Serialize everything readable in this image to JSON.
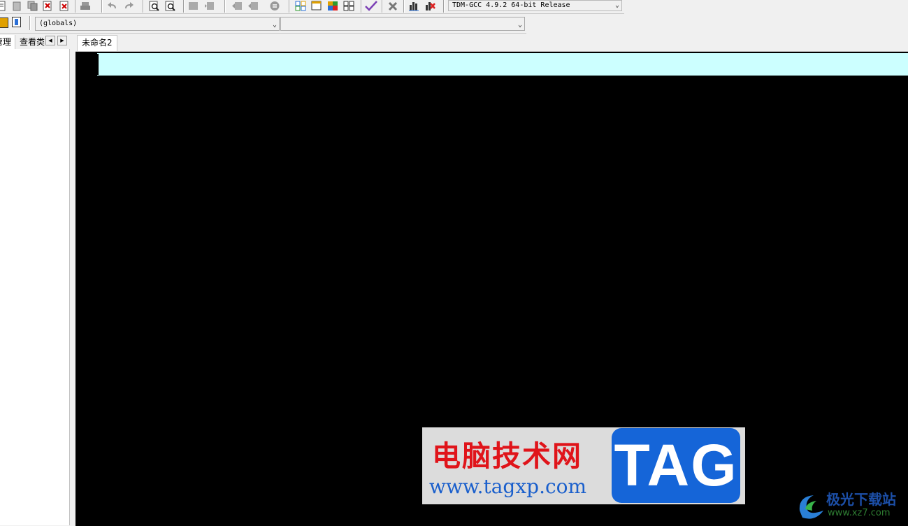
{
  "toolbar": {
    "compiler_select": "TDM-GCC 4.9.2 64-bit Release"
  },
  "class_bar": {
    "scope_select": "(globals)",
    "member_select": ""
  },
  "left_panel": {
    "tabs": [
      "管理",
      "查看类"
    ]
  },
  "editor": {
    "tabs": [
      "未命名2"
    ],
    "colors": {
      "background": "#000000",
      "current_line": "#ccffff"
    }
  },
  "watermark": {
    "title": "电脑技术网",
    "url": "www.tagxp.com",
    "tag": "TAG",
    "site_name": "极光下载站",
    "site_url": "www.xz7.com"
  }
}
